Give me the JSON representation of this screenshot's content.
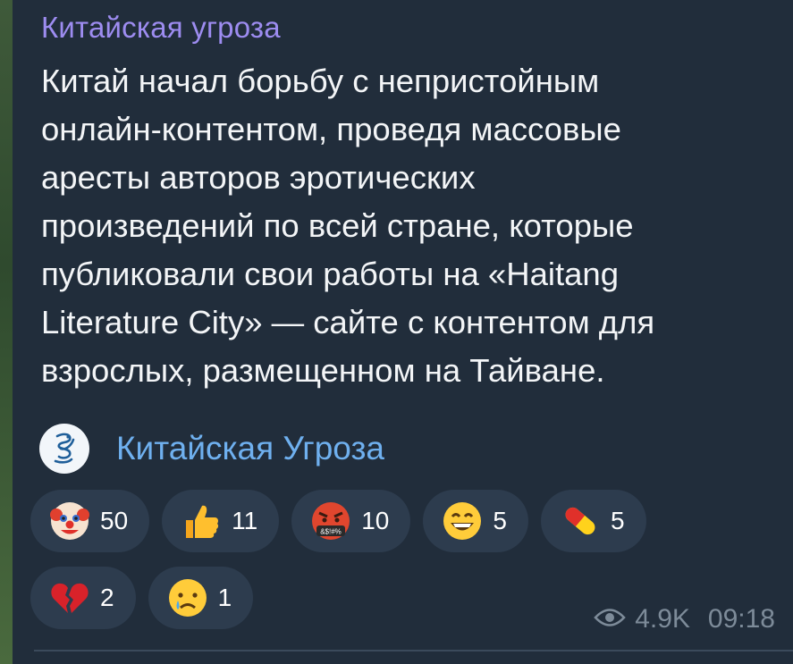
{
  "post": {
    "channel_name": "Китайская угроза",
    "text": "Китай начал борьбу с непристойным\nонлайн-контентом, проведя массовые\nаресты авторов эротических\nпроизведений по всей стране, которые\nпубликовали свои работы на «Haitang\nLiterature City» — сайте с контентом для\nвзрослых, размещенном на Тайване."
  },
  "forward": {
    "channel_name": "Китайская Угроза",
    "avatar_icon": "dragon-logo-icon"
  },
  "reactions": [
    {
      "emoji": "clown-face",
      "count": "50"
    },
    {
      "emoji": "thumbs-up",
      "count": "11"
    },
    {
      "emoji": "face-with-symbols-on-mouth",
      "count": "10"
    },
    {
      "emoji": "grinning-face",
      "count": "5"
    },
    {
      "emoji": "pill",
      "count": "5"
    },
    {
      "emoji": "broken-heart",
      "count": "2"
    },
    {
      "emoji": "crying-face",
      "count": "1"
    }
  ],
  "meta": {
    "views": "4.9K",
    "time": "09:18",
    "views_icon": "eye-icon"
  },
  "colors": {
    "bubble": "#212d3b",
    "channel_name": "#9d8cf0",
    "link": "#6fb0ef",
    "reaction_bg": "#2d3c4e",
    "meta": "#7d8b99"
  }
}
